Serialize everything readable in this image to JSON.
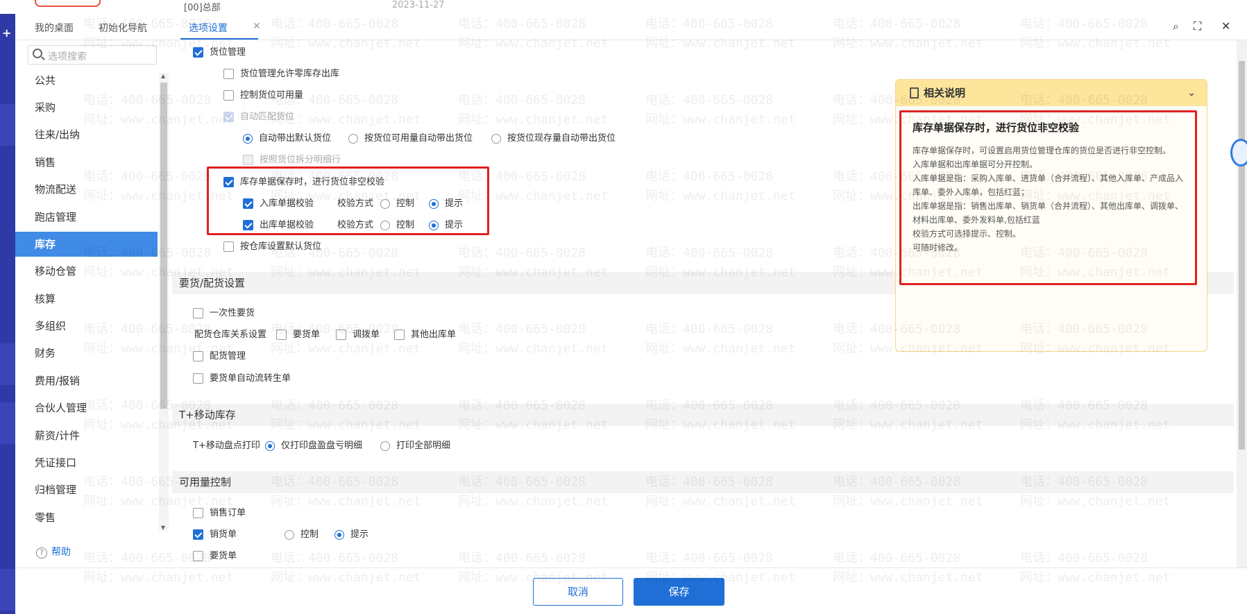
{
  "topbar": {
    "org": "[00]总部",
    "partial_year": "2023-11-27"
  },
  "tabs": [
    {
      "label": "我的桌面"
    },
    {
      "label": "初始化导航"
    },
    {
      "label": "选项设置"
    }
  ],
  "search": {
    "placeholder": "选项搜索"
  },
  "sidebar": {
    "items": [
      "公共",
      "采购",
      "往来/出纳",
      "销售",
      "物流配送",
      "跑店管理",
      "库存",
      "移动仓管",
      "核算",
      "多组织",
      "财务",
      "费用/报销",
      "合伙人管理",
      "薪资/计件",
      "凭证接口",
      "归档管理",
      "零售"
    ],
    "active": "库存",
    "help": "帮助"
  },
  "location": {
    "location_mgmt": "货位管理",
    "zero_stock": "货位管理允许零库存出库",
    "control_available": "控制货位可用量",
    "auto_match": "自动匹配货位",
    "radio_default": "自动带出默认货位",
    "radio_available": "按货位可用量自动带出货位",
    "radio_stock": "按货位现存量自动带出货位",
    "split_detail": "按照货位拆分明细行",
    "nonempty_check": "库存单据保存时，进行货位非空校验",
    "in_check": "入库单据校验",
    "out_check": "出库单据校验",
    "check_mode": "校验方式",
    "control": "控制",
    "prompt": "提示",
    "default_by_wh": "按仓库设置默认货位"
  },
  "allocation": {
    "header": "要货/配货设置",
    "one_time": "一次性要货",
    "wh_relation": "配货仓库关系设置",
    "req_bill": "要货单",
    "transfer": "调拨单",
    "other_out": "其他出库单",
    "alloc_mgmt": "配货管理",
    "auto_flow": "要货单自动流转生单"
  },
  "mobile": {
    "header": "T+移动库存",
    "print_label": "T+移动盘点打印",
    "opt1": "仅打印盘盈盘亏明细",
    "opt2": "打印全部明细"
  },
  "available": {
    "header": "可用量控制",
    "sales_order": "销售订单",
    "sales_bill": "销货单",
    "control": "控制",
    "prompt": "提示",
    "req_bill": "要货单"
  },
  "note": {
    "header": "相关说明",
    "title": "库存单据保存时，进行货位非空校验",
    "lines": [
      "库存单据保存时，可设置启用货位管理仓库的货位是否进行非空控制。",
      "入库单据和出库单据可分开控制。",
      "入库单据是指：采购入库单、进货单（合并流程）、其他入库单、产成品入库单、委外入库单，包括红蓝；",
      "出库单据是指：销售出库单、销货单（合并流程）、其他出库单、调拨单、材料出库单、委外发料单,包括红蓝",
      "校验方式可选择提示、控制。",
      "可随时修改。"
    ]
  },
  "footer": {
    "cancel": "取消",
    "save": "保存"
  },
  "watermark": {
    "phone": "电话：400-665-0028",
    "site": "网址：www.chanjet.net"
  },
  "colors": {
    "accent": "#1f6fd6",
    "highlight_box": "#e02020",
    "note_bg": "#fde59c"
  }
}
